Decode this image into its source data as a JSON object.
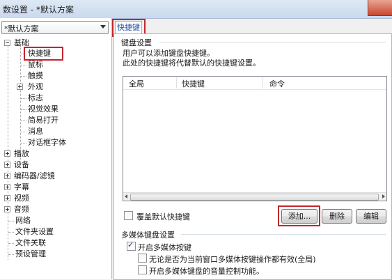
{
  "window": {
    "title": "数设置 - *默认方案"
  },
  "preset": {
    "value": "*默认方案"
  },
  "tree": {
    "root": "基础",
    "items": [
      "快捷键",
      "鼠标",
      "触摸",
      "外观",
      "标志",
      "视觉效果",
      "简易打开",
      "消息",
      "对话框字体"
    ],
    "groups": [
      "播放",
      "设备",
      "编码器/滤镜",
      "字幕",
      "视频",
      "音频"
    ],
    "tail": [
      "网络",
      "文件夹设置",
      "文件关联",
      "预设管理"
    ]
  },
  "tab": {
    "label": "快捷键"
  },
  "keyboard": {
    "title": "键盘设置",
    "desc1": "用户可以添加键盘快捷键。",
    "desc2": "此处的快捷键将代替默认的快捷键设置。",
    "columns": [
      "全局",
      "快捷键",
      "命令"
    ],
    "override_label": "覆盖默认快捷键",
    "add_label": "添加...",
    "delete_label": "删除",
    "edit_label": "编辑"
  },
  "media": {
    "title": "多媒体键盘设置",
    "enable_label": "开启多媒体按键",
    "global_label": "无论是否为当前窗口多媒体按键操作都有效(全局)",
    "volume_label": "开启多媒体键盘的音量控制功能。"
  }
}
